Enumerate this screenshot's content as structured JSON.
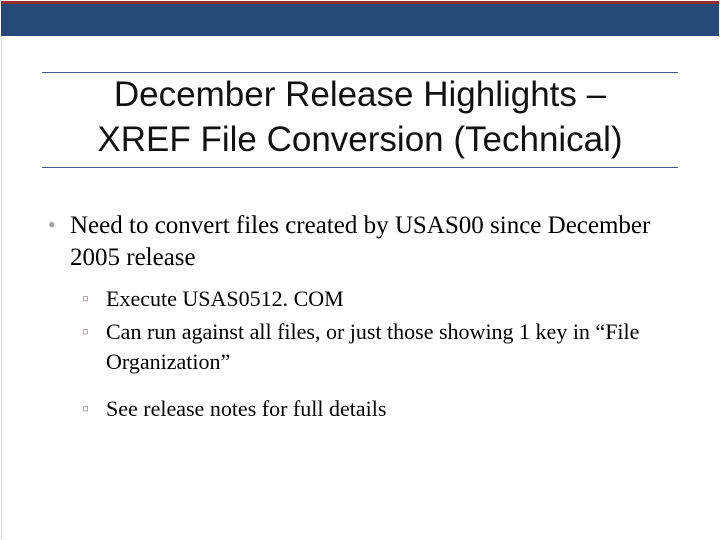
{
  "title_line1": "December Release Highlights –",
  "title_line2": "XREF File Conversion (Technical)",
  "bullets": {
    "b1": "Need to convert files created by USAS00 since December 2005 release",
    "sub1": "Execute USAS0512. COM",
    "sub2": "Can run against all files, or just those showing 1 key in “File Organization”",
    "sub3": "See release notes for full details"
  }
}
